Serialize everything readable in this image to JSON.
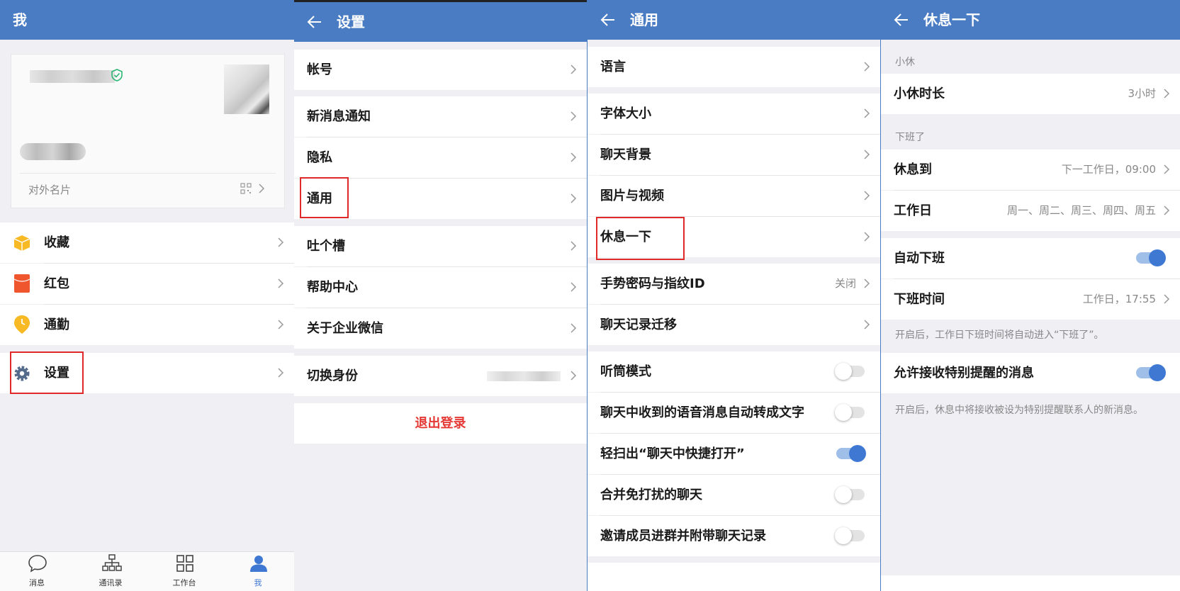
{
  "me": {
    "header_title": "我",
    "card_label": "对外名片",
    "items": [
      {
        "label": "收藏"
      },
      {
        "label": "红包"
      },
      {
        "label": "通勤"
      },
      {
        "label": "设置"
      }
    ],
    "tabs": [
      {
        "label": "消息",
        "icon": "chat-icon"
      },
      {
        "label": "通讯录",
        "icon": "contacts-icon"
      },
      {
        "label": "工作台",
        "icon": "grid-icon"
      },
      {
        "label": "我",
        "icon": "person-icon"
      }
    ]
  },
  "settings": {
    "header_title": "设置",
    "items": [
      {
        "label": "帐号"
      },
      {
        "label": "新消息通知"
      },
      {
        "label": "隐私"
      },
      {
        "label": "通用"
      },
      {
        "label": "吐个槽"
      },
      {
        "label": "帮助中心"
      },
      {
        "label": "关于企业微信"
      },
      {
        "label": "切换身份"
      }
    ],
    "logout_label": "退出登录"
  },
  "general": {
    "header_title": "通用",
    "items": [
      {
        "label": "语言"
      },
      {
        "label": "字体大小"
      },
      {
        "label": "聊天背景"
      },
      {
        "label": "图片与视频"
      },
      {
        "label": "休息一下"
      },
      {
        "label": "手势密码与指纹ID",
        "value": "关闭"
      },
      {
        "label": "聊天记录迁移"
      }
    ],
    "toggles": [
      {
        "label": "听筒模式",
        "on": false
      },
      {
        "label": "聊天中收到的语音消息自动转成文字",
        "on": false
      },
      {
        "label": "轻扫出“聊天中快捷打开”",
        "on": true
      },
      {
        "label": "合并免打扰的聊天",
        "on": false
      },
      {
        "label": "邀请成员进群并附带聊天记录",
        "on": false
      }
    ]
  },
  "rest": {
    "header_title": "休息一下",
    "section1": "小休",
    "break_duration_label": "小休时长",
    "break_duration_value": "3小时",
    "section2": "下班了",
    "rest_until_label": "休息到",
    "rest_until_value": "下一工作日，09:00",
    "workday_label": "工作日",
    "workday_value": "周一、周二、周三、周四、周五",
    "auto_off_label": "自动下班",
    "auto_off_on": true,
    "off_time_label": "下班时间",
    "off_time_value": "工作日，17:55",
    "note1": "开启后，工作日下班时间将自动进入“下班了”。",
    "allow_label": "允许接收特别提醒的消息",
    "allow_on": true,
    "note2": "开启后，休息中将接收被设为特别提醒联系人的新消息。"
  },
  "colors": {
    "header": "#4a7cc4",
    "accent": "#3e78d3",
    "logout": "#e53935",
    "highlight_box": "#e02a2a"
  }
}
